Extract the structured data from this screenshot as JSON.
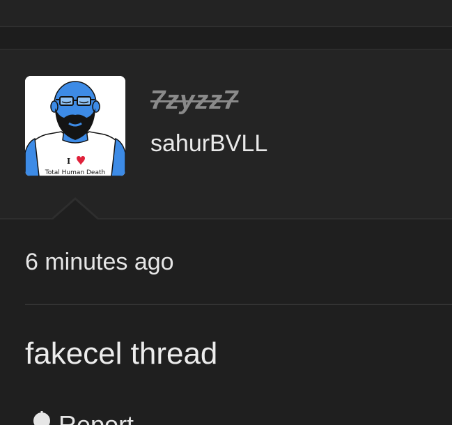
{
  "profile": {
    "old_username": "7zyzz7",
    "username": "sahurBVLL",
    "avatar": {
      "icon": "avatar-icon",
      "shirt_text_top": "I",
      "shirt_text_bottom": "Total Human Death"
    }
  },
  "post": {
    "timestamp": "6 minutes ago",
    "body": "fakecel thread"
  },
  "actions": {
    "report_label": "Report",
    "report_icon": "flag-icon"
  },
  "colors": {
    "background": "#1f1f1f",
    "profile_background": "#242424",
    "text": "#e9e9e9",
    "muted_text": "#8a8a8a",
    "avatar_blue": "#3d8be6",
    "heart_red": "#e0213a"
  }
}
